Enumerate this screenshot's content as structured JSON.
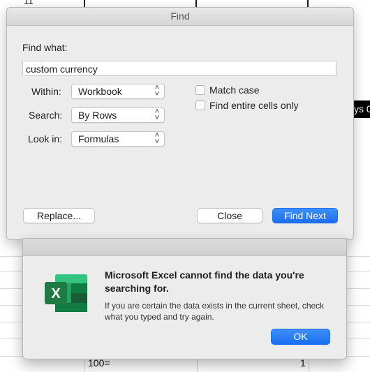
{
  "sheet": {
    "top_cell": "11",
    "dark_cell": "ys 0",
    "bottom_left_cell": "100=",
    "bottom_right_cell": "1"
  },
  "find_dialog": {
    "title": "Find",
    "find_what_label": "Find what:",
    "find_what_value": "custom currency",
    "within_label": "Within:",
    "within_value": "Workbook",
    "search_label": "Search:",
    "search_value": "By Rows",
    "look_in_label": "Look in:",
    "look_in_value": "Formulas",
    "match_case_label": "Match case",
    "match_case_checked": false,
    "entire_cells_label": "Find entire cells only",
    "entire_cells_checked": false,
    "replace_label": "Replace...",
    "close_label": "Close",
    "find_next_label": "Find Next"
  },
  "alert": {
    "icon": "excel-app-icon",
    "icon_letter": "X",
    "title": "Microsoft Excel cannot find the data you're searching for.",
    "message": "If you are certain the data exists in the current sheet, check what you typed and try again.",
    "ok_label": "OK"
  },
  "colors": {
    "accent": "#1a6ff0",
    "excel_green": "#1f7a43"
  }
}
